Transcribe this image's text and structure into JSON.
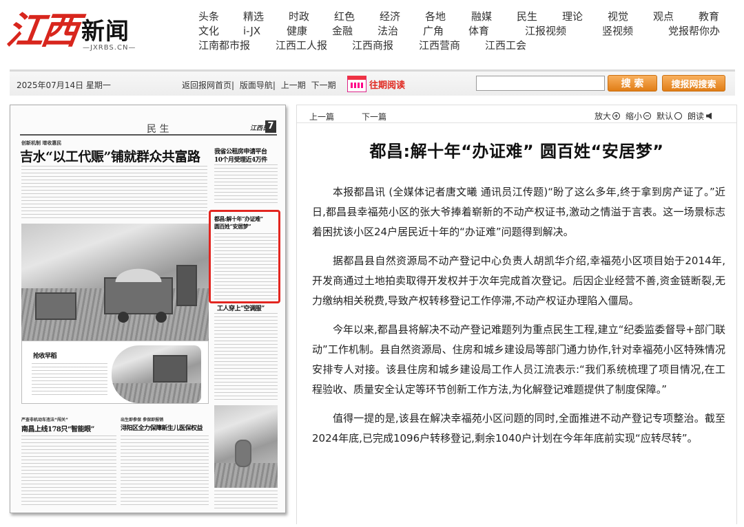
{
  "site": {
    "logo_brush": "江西",
    "logo_text": "新闻",
    "logo_domain": "—JXRBS.CN—"
  },
  "nav": {
    "row1": [
      "头条",
      "精选",
      "时政",
      "红色",
      "经济",
      "各地",
      "融媒",
      "民生",
      "理论",
      "视觉",
      "观点",
      "教育"
    ],
    "row2": [
      "文化",
      "i-JX",
      "健康",
      "金融",
      "法治",
      "广角",
      "体育",
      "江报视频",
      "竖视频",
      "党报帮你办"
    ],
    "row3": [
      "江南都市报",
      "江西工人报",
      "江西商报",
      "江西营商",
      "江西工会"
    ]
  },
  "toolbar": {
    "date": "2025年07月14日 星期一",
    "links": [
      "返回报网首页|",
      "版面导航|",
      "上一期",
      "下一期"
    ],
    "archive_label": "往期阅读",
    "search_value": "",
    "search_button": "搜 索",
    "site_search_button": "搜报网搜索"
  },
  "paper": {
    "section": "民 生",
    "paper_name": "江西日报",
    "page_number": "7",
    "kicker_main": "创新机制 增收惠民",
    "headline_main": "吉水“以工代赈”铺就群众共富路",
    "headline_right_1": "我省公租房申请平台",
    "headline_right_2": "10个月受理近4万件",
    "headline_hl_1": "都昌:解十年“办证难”",
    "headline_hl_2": "圆百姓“安居梦”",
    "headline_workers": "工人穿上“空调服”",
    "headline_harvest": "抢收早稻",
    "kicker_bl": "严查非机动车违法“闯关”",
    "headline_bl": "南昌上线178只“智能眼”",
    "kicker_bm": "出生即参保 参保即报销",
    "headline_bm": "浔阳区全力保障新生儿医保权益"
  },
  "article": {
    "prev": "上一篇",
    "next": "下一篇",
    "zoom_in": "放大",
    "zoom_out": "缩小",
    "default": "默认",
    "read_aloud": "朗读",
    "title": "都昌:解十年“办证难” 圆百姓“安居梦”",
    "paragraphs": [
      "本报都昌讯 (全媒体记者唐文曦 通讯员江传题)“盼了这么多年,终于拿到房产证了。”近日,都昌县幸福苑小区的张大爷捧着崭新的不动产权证书,激动之情溢于言表。这一场景标志着困扰该小区24户居民近十年的“办证难”问题得到解决。",
      "据都昌县自然资源局不动产登记中心负责人胡凯华介绍,幸福苑小区项目始于2014年,开发商通过土地拍卖取得开发权并于次年完成首次登记。后因企业经营不善,资金链断裂,无力缴纳相关税费,导致产权转移登记工作停滞,不动产权证办理陷入僵局。",
      "今年以来,都昌县将解决不动产登记难题列为重点民生工程,建立“纪委监委督导+部门联动”工作机制。县自然资源局、住房和城乡建设局等部门通力协作,针对幸福苑小区特殊情况安排专人对接。该县住房和城乡建设局工作人员江流表示:“我们系统梳理了项目情况,在工程验收、质量安全认定等环节创新工作方法,为化解登记难题提供了制度保障。”",
      "值得一提的是,该县在解决幸福苑小区问题的同时,全面推进不动产登记专项整治。截至2024年底,已完成1096户转移登记,剩余1040户计划在今年年底前实现“应转尽转”。"
    ]
  }
}
